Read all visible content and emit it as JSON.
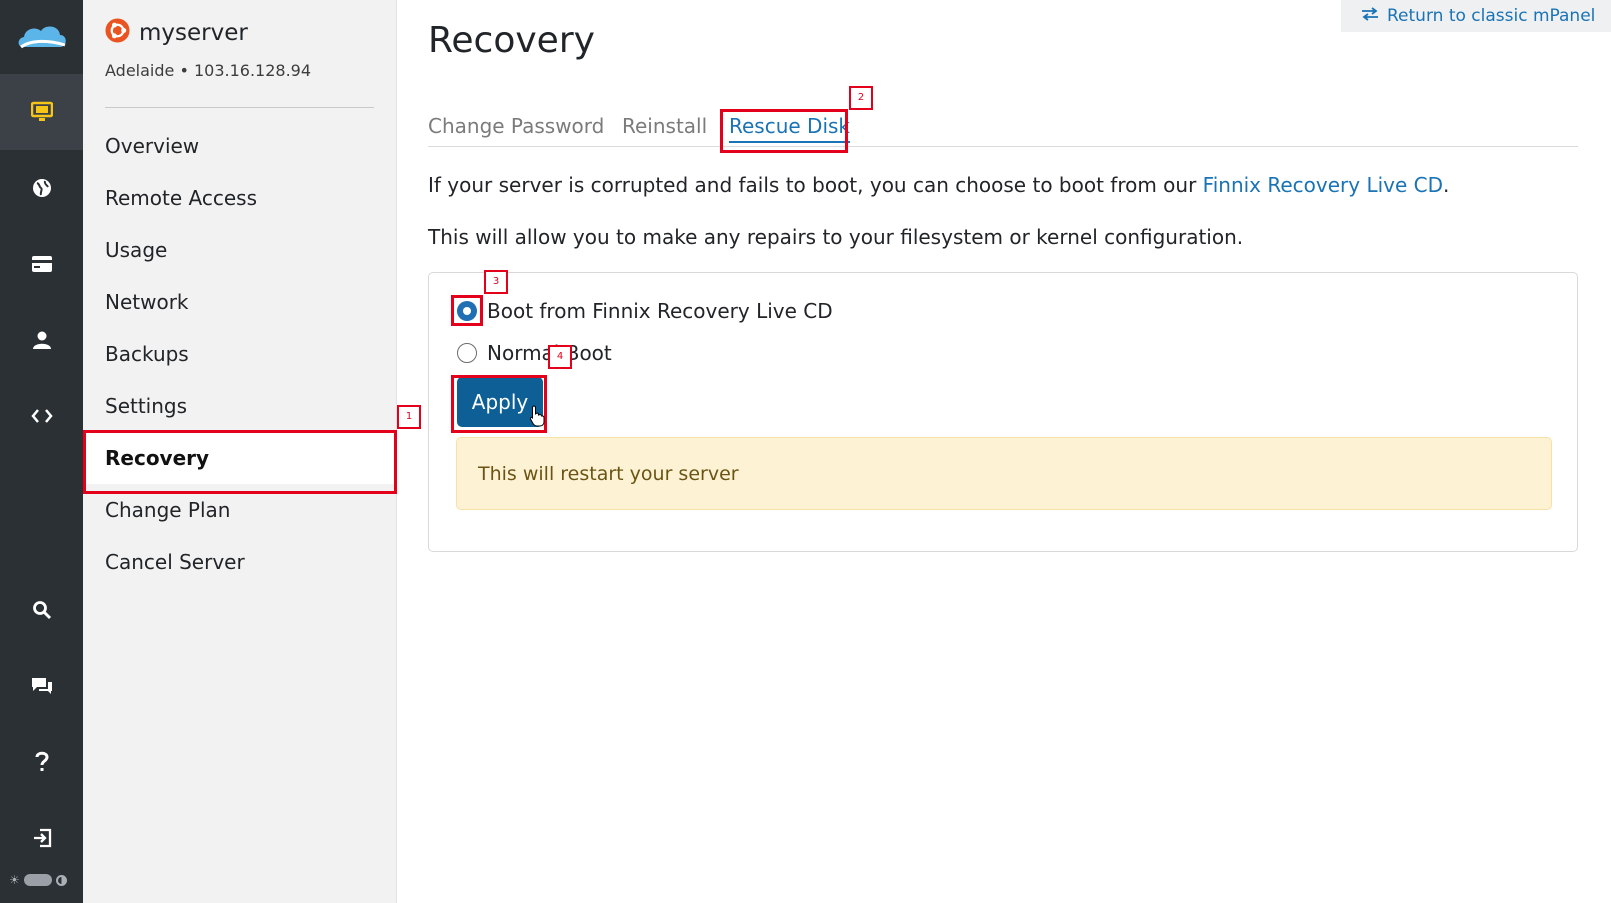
{
  "rail": {
    "items": [
      {
        "icon": "monitor-icon",
        "active": true
      },
      {
        "icon": "globe-icon"
      },
      {
        "icon": "credit-card-icon"
      },
      {
        "icon": "user-icon"
      },
      {
        "icon": "code-icon"
      },
      {
        "icon": "search-icon"
      },
      {
        "icon": "chat-icon"
      },
      {
        "icon": "help-icon"
      },
      {
        "icon": "logout-icon"
      }
    ],
    "colors": {
      "background": "#2b3035",
      "active_icon": "#f5c518",
      "icon": "#ffffff"
    }
  },
  "server": {
    "name": "myserver",
    "location": "Adelaide • 103.16.128.94",
    "os_icon": "ubuntu-icon"
  },
  "nav": {
    "items": [
      {
        "label": "Overview"
      },
      {
        "label": "Remote Access"
      },
      {
        "label": "Usage"
      },
      {
        "label": "Network"
      },
      {
        "label": "Backups"
      },
      {
        "label": "Settings"
      },
      {
        "label": "Recovery",
        "active": true
      },
      {
        "label": "Change Plan"
      },
      {
        "label": "Cancel Server"
      }
    ]
  },
  "header": {
    "classic_link": "Return to classic mPanel"
  },
  "main": {
    "title": "Recovery",
    "tabs": [
      {
        "label": "Change Password"
      },
      {
        "label": "Reinstall"
      },
      {
        "label": "Rescue Disk",
        "active": true
      }
    ],
    "intro_before": "If your server is corrupted and fails to boot, you can choose to boot from our ",
    "intro_link": "Finnix Recovery Live CD",
    "intro_after": ".",
    "intro2": "This will allow you to make any repairs to your filesystem or kernel configuration.",
    "options": [
      {
        "label": "Boot from Finnix Recovery Live CD",
        "checked": true
      },
      {
        "label": "Normal Boot",
        "checked": false
      }
    ],
    "apply_label": "Apply",
    "warning": "This will restart your server"
  },
  "annotations": [
    "1",
    "2",
    "3",
    "4"
  ],
  "colors": {
    "link": "#1a73b5",
    "primary_button": "#0d5f96",
    "annotation": "#e4001b",
    "warning_bg": "#fdf3d4"
  }
}
